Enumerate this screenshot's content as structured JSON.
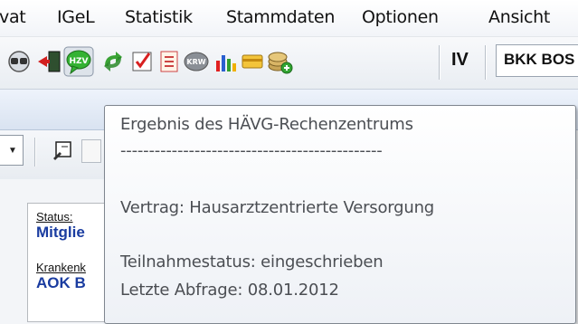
{
  "menu": {
    "items": [
      "vat",
      "IGeL",
      "Statistik",
      "Stammdaten",
      "Optionen",
      "Ansicht"
    ]
  },
  "toolbar": {
    "iv_label": "IV",
    "kasse_value": "BKK BOS",
    "icons": [
      "glasses-icon",
      "exit-door-icon",
      "hzv-icon",
      "green-arrows-icon",
      "checklist-icon",
      "document-list-icon",
      "krw-icon",
      "bar-chart-icon",
      "card-reader-icon",
      "coins-add-icon"
    ]
  },
  "patient": {
    "status_label": "Status:",
    "status_value": "Mitglie",
    "kasse_label": "Krankenk",
    "kasse_value": "AOK B"
  },
  "tooltip": {
    "title": "Ergebnis des HÄVG-Rechenzentrums",
    "divider": "----------------------------------------------",
    "vertrag": "Vertrag: Hausarztzentrierte Versorgung",
    "teilnahmestatus": "Teilnahmestatus: eingeschrieben",
    "letzte_abfrage": "Letzte Abfrage: 08.01.2012"
  },
  "colors": {
    "link_blue": "#1a3ca0",
    "tooltip_text": "#4b4e53"
  }
}
